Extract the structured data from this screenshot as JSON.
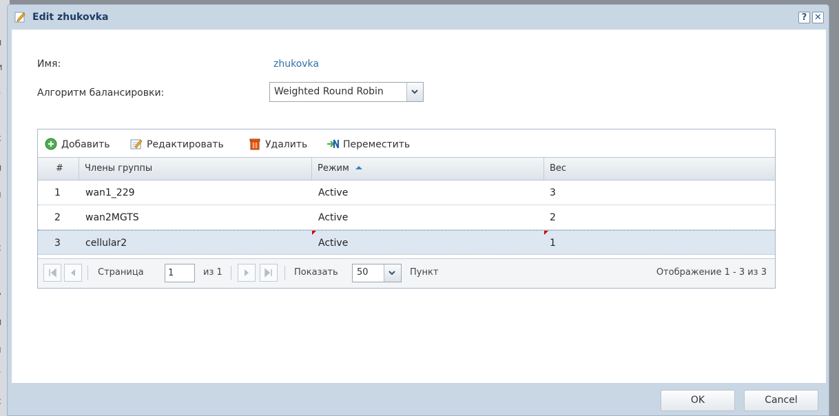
{
  "background_page": {
    "fragments": [
      "Н",
      "М",
      "З",
      "С",
      "И",
      "Я",
      "k",
      "С",
      "А",
      "И",
      "Я",
      "Т",
      "С"
    ]
  },
  "dialog": {
    "title": "Edit zhukovka",
    "help_glyph": "?",
    "close_glyph": "✕"
  },
  "form": {
    "name_label": "Имя:",
    "name_value": "zhukovka",
    "algorithm_label": "Алгоритм балансировки:",
    "algorithm_value": "Weighted Round Robin"
  },
  "toolbar": {
    "add_label": "Добавить",
    "edit_label": "Редактировать",
    "delete_label": "Удалить",
    "move_label": "Переместить"
  },
  "table": {
    "columns": {
      "num": "#",
      "members": "Члены группы",
      "mode": "Режим",
      "weight": "Вес"
    },
    "sort_column": "mode",
    "rows": [
      {
        "num": "1",
        "member": "wan1_229",
        "mode": "Active",
        "weight": "3"
      },
      {
        "num": "2",
        "member": "wan2MGTS",
        "mode": "Active",
        "weight": "2"
      },
      {
        "num": "3",
        "member": "cellular2",
        "mode": "Active",
        "weight": "1"
      }
    ],
    "selected_row": 3
  },
  "pager": {
    "page_label": "Страница",
    "page_value": "1",
    "of_label": "из 1",
    "show_label": "Показать",
    "page_size": "50",
    "item_label": "Пункт",
    "summary": "Отображение 1 - 3 из 3"
  },
  "footer": {
    "ok_label": "OK",
    "cancel_label": "Cancel"
  },
  "colors": {
    "accent": "#2f6fa5",
    "title": "#1e3c66",
    "selected_row": "#dde7f2",
    "dirty_marker": "#cc0000"
  }
}
